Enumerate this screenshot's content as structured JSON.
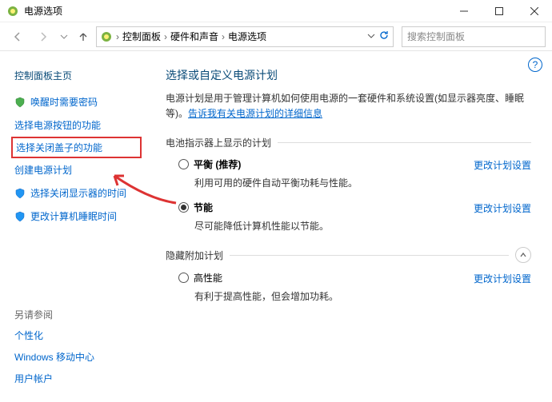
{
  "window": {
    "title": "电源选项"
  },
  "breadcrumb": {
    "root": "控制面板",
    "mid": "硬件和声音",
    "leaf": "电源选项"
  },
  "search": {
    "placeholder": "搜索控制面板"
  },
  "sidebar": {
    "home": "控制面板主页",
    "items": [
      "唤醒时需要密码",
      "选择电源按钮的功能",
      "选择关闭盖子的功能",
      "创建电源计划",
      "选择关闭显示器的时间",
      "更改计算机睡眠时间"
    ],
    "see_also": "另请参阅",
    "see_items": [
      "个性化",
      "Windows 移动中心",
      "用户帐户"
    ]
  },
  "main": {
    "heading": "选择或自定义电源计划",
    "desc_pre": "电源计划是用于管理计算机如何使用电源的一套硬件和系统设置(如显示器亮度、睡眠等)。",
    "tell_more": "告诉我有关电源计划的详细信息",
    "section_shown": "电池指示器上显示的计划",
    "section_hidden": "隐藏附加计划",
    "change_settings": "更改计划设置",
    "plans": [
      {
        "name": "平衡",
        "recommend": "(推荐)",
        "desc": "利用可用的硬件自动平衡功耗与性能。",
        "selected": false
      },
      {
        "name": "节能",
        "recommend": "",
        "desc": "尽可能降低计算机性能以节能。",
        "selected": true
      }
    ],
    "hidden_plans": [
      {
        "name": "高性能",
        "recommend": "",
        "desc": "有利于提高性能，但会增加功耗。",
        "selected": false
      }
    ]
  }
}
